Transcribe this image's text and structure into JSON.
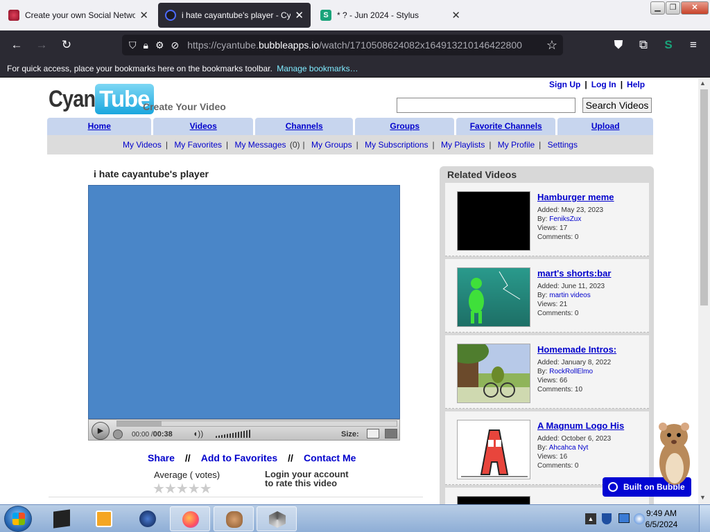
{
  "browser": {
    "tabs": [
      {
        "title": "Create your own Social Network",
        "close": "✕"
      },
      {
        "title": "i hate cayantube's player - CyanTube",
        "close": "✕"
      },
      {
        "title": "* ? - Jun 2024 - Stylus",
        "close": "✕"
      }
    ],
    "url_prefix": "https://cyantube.",
    "url_domain": "bubbleapps.io",
    "url_path": "/watch/1710508624082x164913210146422800",
    "bookmarks_text": "For quick access, place your bookmarks here on the bookmarks toolbar.",
    "bookmarks_link": "Manage bookmarks…",
    "icons": [
      "back-icon",
      "forward-icon",
      "reload-icon",
      "shield-icon",
      "lock-icon",
      "star-icon",
      "pocket-icon",
      "extensions-icon",
      "menu-icon"
    ]
  },
  "site": {
    "logo_cyan": "Cyan",
    "logo_tube": "Tube",
    "slogan": "Create Your Video",
    "top_links": [
      "Sign Up",
      "Log In",
      "Help"
    ],
    "top_sep": "|",
    "search_value": "",
    "search_button": "Search Videos",
    "main_tabs": [
      "Home",
      "Videos",
      "Channels",
      "Groups",
      "Favorite Channels",
      "Upload"
    ],
    "sub_nav": {
      "my_videos": "My Videos",
      "my_favorites": "My Favorites",
      "my_messages": "My Messages",
      "messages_count": "(0)",
      "my_groups": "My Groups",
      "my_subscriptions": "My Subscriptions",
      "my_playlists": "My Playlists",
      "my_profile": "My Profile",
      "settings": "Settings"
    }
  },
  "video": {
    "title": "i hate cayantube's player",
    "current_time": "00:00",
    "slash": "/",
    "total_time": "00:38",
    "size_label": "Size:",
    "progress": 0.16,
    "colors": {
      "player_bg": "#4a86c8"
    }
  },
  "actions": {
    "share": "Share",
    "sep": "//",
    "add_favorites": "Add to Favorites",
    "contact": "Contact Me"
  },
  "rating": {
    "average": "Average ( votes)",
    "stars": "★★★★★",
    "login_line1": "Login your account",
    "login_line2": "to rate this video"
  },
  "related": {
    "title": "Related Videos",
    "items": [
      {
        "title": "Hamburger meme ",
        "added": "Added: May 23, 2023",
        "by_label": "By: ",
        "by": "FeniksZux",
        "views": "Views: 17",
        "comments": "Comments: 0"
      },
      {
        "title": "mart's shorts:bar",
        "added": "Added: June 11, 2023",
        "by_label": "By: ",
        "by": "martin videos",
        "views": "Views: 21",
        "comments": "Comments: 0"
      },
      {
        "title": "Homemade Intros: ",
        "added": "Added: January 8, 2022",
        "by_label": "By: ",
        "by": "RockRollElmo",
        "views": "Views: 66",
        "comments": "Comments: 10"
      },
      {
        "title": "A Magnum Logo His",
        "added": "Added: October 6, 2023",
        "by_label": "By: ",
        "by": "Ahcahca Nyt",
        "views": "Views: 16",
        "comments": "Comments: 0"
      }
    ]
  },
  "bubble_badge": "Built on Bubble",
  "taskbar": {
    "time": "9:49 AM",
    "date": "6/5/2024"
  }
}
